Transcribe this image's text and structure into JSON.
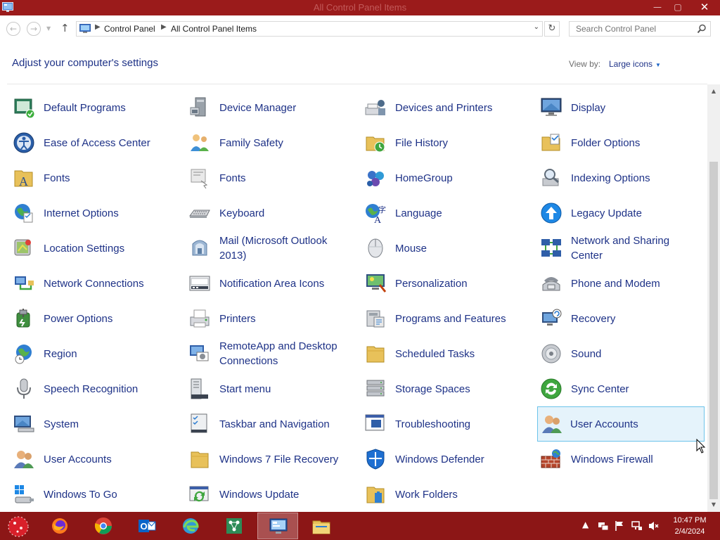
{
  "window": {
    "title": "All Control Panel Items",
    "minimize_glyph": "—",
    "maximize_glyph": "▢",
    "close_glyph": "✕"
  },
  "address_bar": {
    "back_glyph": "←",
    "forward_glyph": "→",
    "up_glyph": "↑",
    "refresh_glyph": "↻",
    "crumbs": [
      "Control Panel",
      "All Control Panel Items"
    ],
    "search_placeholder": "Search Control Panel"
  },
  "header": {
    "title": "Adjust your computer's settings",
    "view_by_label": "View by:",
    "view_by_value": "Large icons"
  },
  "items": [
    {
      "label": "Default Programs",
      "icon": "default-programs-icon"
    },
    {
      "label": "Device Manager",
      "icon": "device-manager-icon"
    },
    {
      "label": "Devices and Printers",
      "icon": "devices-printers-icon"
    },
    {
      "label": "Display",
      "icon": "display-icon"
    },
    {
      "label": "Ease of Access Center",
      "icon": "ease-of-access-icon"
    },
    {
      "label": "Family Safety",
      "icon": "family-safety-icon"
    },
    {
      "label": "File History",
      "icon": "file-history-icon"
    },
    {
      "label": "Folder Options",
      "icon": "folder-options-icon"
    },
    {
      "label": "Fonts",
      "icon": "fonts-icon"
    },
    {
      "label": "Fonts",
      "icon": "fonts-shortcut-icon"
    },
    {
      "label": "HomeGroup",
      "icon": "homegroup-icon"
    },
    {
      "label": "Indexing Options",
      "icon": "indexing-options-icon"
    },
    {
      "label": "Internet Options",
      "icon": "internet-options-icon"
    },
    {
      "label": "Keyboard",
      "icon": "keyboard-icon"
    },
    {
      "label": "Language",
      "icon": "language-icon"
    },
    {
      "label": "Legacy Update",
      "icon": "legacy-update-icon"
    },
    {
      "label": "Location Settings",
      "icon": "location-settings-icon"
    },
    {
      "label": "Mail (Microsoft Outlook 2013)",
      "icon": "mail-icon"
    },
    {
      "label": "Mouse",
      "icon": "mouse-icon"
    },
    {
      "label": "Network and Sharing Center",
      "icon": "network-sharing-icon"
    },
    {
      "label": "Network Connections",
      "icon": "network-connections-icon"
    },
    {
      "label": "Notification Area Icons",
      "icon": "notification-area-icon"
    },
    {
      "label": "Personalization",
      "icon": "personalization-icon"
    },
    {
      "label": "Phone and Modem",
      "icon": "phone-modem-icon"
    },
    {
      "label": "Power Options",
      "icon": "power-options-icon"
    },
    {
      "label": "Printers",
      "icon": "printers-icon"
    },
    {
      "label": "Programs and Features",
      "icon": "programs-features-icon"
    },
    {
      "label": "Recovery",
      "icon": "recovery-icon"
    },
    {
      "label": "Region",
      "icon": "region-icon"
    },
    {
      "label": "RemoteApp and Desktop Connections",
      "icon": "remoteapp-icon"
    },
    {
      "label": "Scheduled Tasks",
      "icon": "scheduled-tasks-icon"
    },
    {
      "label": "Sound",
      "icon": "sound-icon"
    },
    {
      "label": "Speech Recognition",
      "icon": "speech-recognition-icon"
    },
    {
      "label": "Start menu",
      "icon": "start-menu-icon"
    },
    {
      "label": "Storage Spaces",
      "icon": "storage-spaces-icon"
    },
    {
      "label": "Sync Center",
      "icon": "sync-center-icon"
    },
    {
      "label": "System",
      "icon": "system-icon"
    },
    {
      "label": "Taskbar and Navigation",
      "icon": "taskbar-navigation-icon"
    },
    {
      "label": "Troubleshooting",
      "icon": "troubleshooting-icon"
    },
    {
      "label": "User Accounts",
      "icon": "user-accounts-icon",
      "selected": true
    },
    {
      "label": "User Accounts",
      "icon": "user-accounts-icon"
    },
    {
      "label": "Windows 7 File Recovery",
      "icon": "file-recovery-icon"
    },
    {
      "label": "Windows Defender",
      "icon": "windows-defender-icon"
    },
    {
      "label": "Windows Firewall",
      "icon": "windows-firewall-icon"
    },
    {
      "label": "Windows To Go",
      "icon": "windows-to-go-icon"
    },
    {
      "label": "Windows Update",
      "icon": "windows-update-icon"
    },
    {
      "label": "Work Folders",
      "icon": "work-folders-icon"
    }
  ],
  "taskbar": {
    "apps": [
      {
        "name": "firefox-icon",
        "active": false
      },
      {
        "name": "chrome-icon",
        "active": false
      },
      {
        "name": "outlook-icon",
        "active": false
      },
      {
        "name": "edge-icon",
        "active": false
      },
      {
        "name": "network-app-icon",
        "active": false
      },
      {
        "name": "control-panel-icon",
        "active": true
      },
      {
        "name": "file-explorer-icon",
        "active": false
      }
    ],
    "tray_overflow_glyph": "▲",
    "time": "10:47 PM",
    "date": "2/4/2024"
  },
  "colors": {
    "title_bar": "#9b1b1b",
    "taskbar": "#8c1616",
    "link_text": "#1e3287",
    "selection_bg": "#e5f3fb",
    "selection_border": "#6cc3ea"
  }
}
